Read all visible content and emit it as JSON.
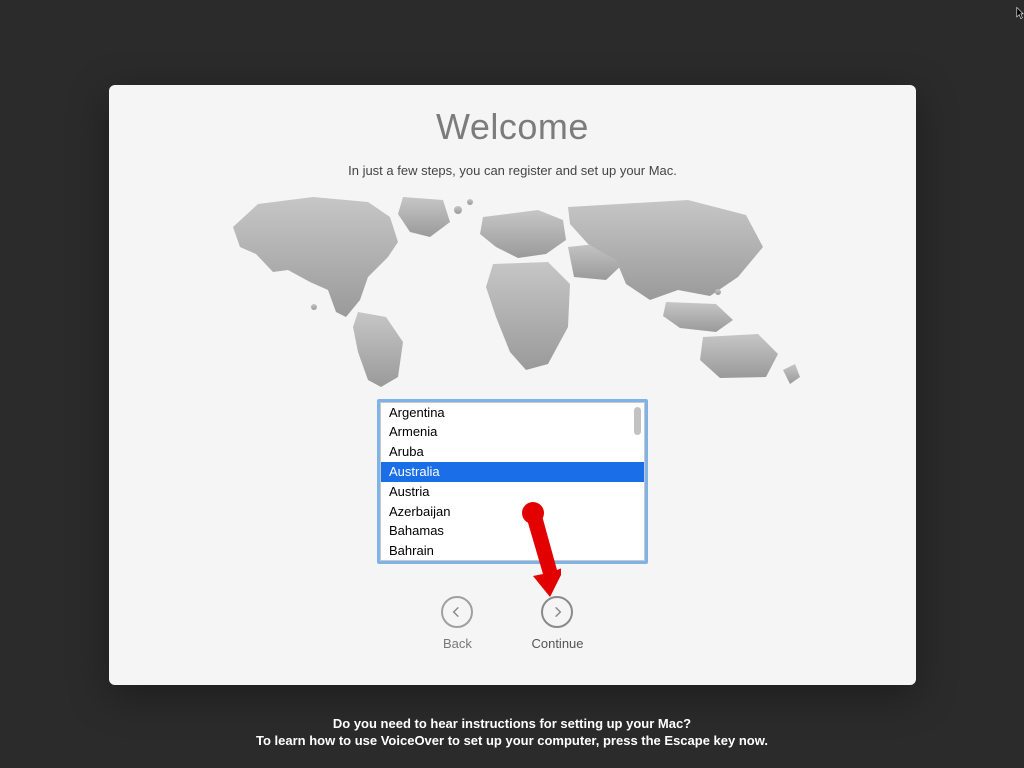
{
  "panel": {
    "title": "Welcome",
    "subtitle": "In just a few steps, you can register and set up your Mac."
  },
  "country_list": {
    "items": [
      "Argentina",
      "Armenia",
      "Aruba",
      "Australia",
      "Austria",
      "Azerbaijan",
      "Bahamas",
      "Bahrain"
    ],
    "selected_index": 3
  },
  "nav": {
    "back_label": "Back",
    "continue_label": "Continue"
  },
  "footer": {
    "line1": "Do you need to hear instructions for setting up your Mac?",
    "line2": "To learn how to use VoiceOver to set up your computer, press the Escape key now."
  },
  "colors": {
    "selection": "#1a6fe8",
    "focus_ring": "#7fb2e8",
    "annotation_arrow": "#e30000"
  }
}
